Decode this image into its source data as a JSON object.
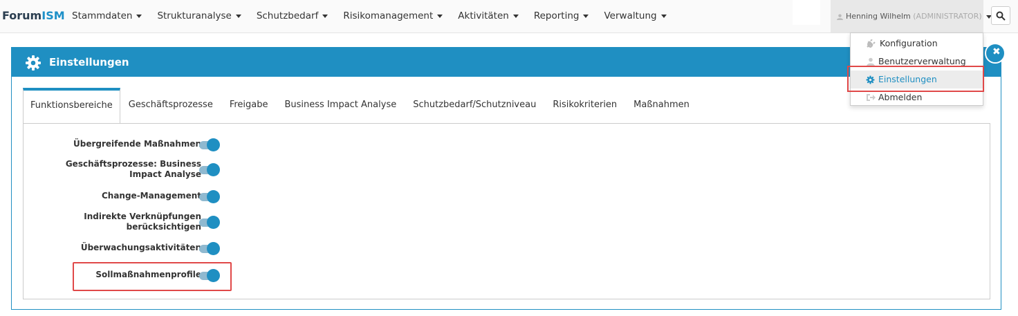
{
  "brand": {
    "part1": "Forum",
    "part2": "ISM"
  },
  "nav": {
    "items": [
      {
        "label": "Stammdaten"
      },
      {
        "label": "Strukturanalyse"
      },
      {
        "label": "Schutzbedarf"
      },
      {
        "label": "Risikomanagement"
      },
      {
        "label": "Aktivitäten"
      },
      {
        "label": "Reporting"
      },
      {
        "label": "Verwaltung"
      }
    ]
  },
  "user": {
    "name": "Henning Wilhelm",
    "role": "(ADMINISTRATOR)"
  },
  "user_dropdown": {
    "items": [
      {
        "label": "Konfiguration",
        "icon": "plug-icon"
      },
      {
        "label": "Benutzerverwaltung",
        "icon": "users-icon"
      },
      {
        "label": "Einstellungen",
        "icon": "gear-icon",
        "active": true
      },
      {
        "label": "Abmelden",
        "icon": "sign-out-icon"
      }
    ]
  },
  "panel": {
    "title": "Einstellungen"
  },
  "tabs": [
    {
      "label": "Funktionsbereiche",
      "active": true
    },
    {
      "label": "Geschäftsprozesse"
    },
    {
      "label": "Freigabe"
    },
    {
      "label": "Business Impact Analyse"
    },
    {
      "label": "Schutzbedarf/Schutzniveau"
    },
    {
      "label": "Risikokriterien"
    },
    {
      "label": "Maßnahmen"
    }
  ],
  "settings": [
    {
      "label": "Übergreifende Maßnahmen",
      "enabled": true
    },
    {
      "label": "Geschäftsprozesse: Business Impact Analyse",
      "enabled": true
    },
    {
      "label": "Change-Management",
      "enabled": true
    },
    {
      "label": "Indirekte Verknüpfungen berücksichtigen",
      "enabled": true
    },
    {
      "label": "Überwachungsaktivitäten",
      "enabled": true
    },
    {
      "label": "Sollmaßnahmenprofile",
      "enabled": true
    }
  ],
  "colors": {
    "accent": "#1f8fc2",
    "highlight": "#e04848",
    "toggle_track": "#8fb9d0"
  }
}
